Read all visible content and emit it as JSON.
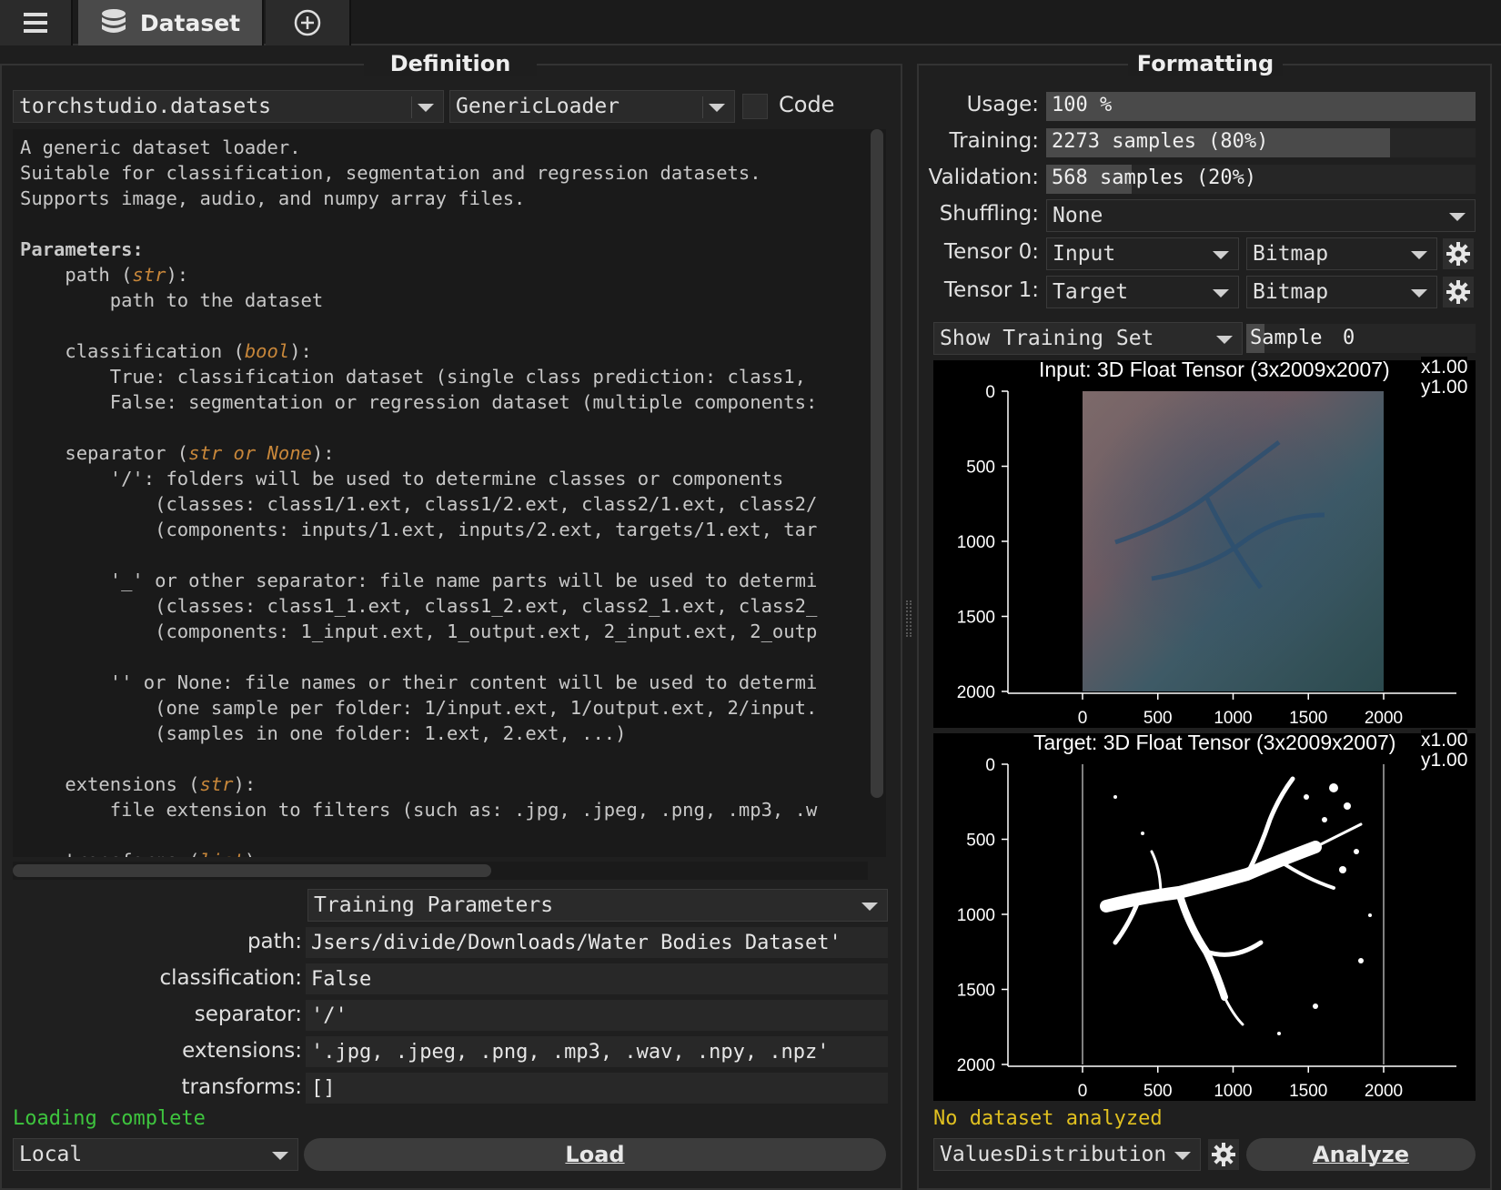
{
  "tabs": {
    "dataset_label": "Dataset"
  },
  "definition": {
    "title": "Definition",
    "module": "torchstudio.datasets",
    "loader": "GenericLoader",
    "code_label": "Code",
    "doc_lines": [
      "A generic dataset loader.",
      "Suitable for classification, segmentation and regression datasets.",
      "Supports image, audio, and numpy array files.",
      "",
      "Parameters:",
      "    path (str):",
      "        path to the dataset",
      "",
      "    classification (bool):",
      "        True: classification dataset (single class prediction: class1, ",
      "        False: segmentation or regression dataset (multiple components: ",
      "",
      "    separator (str or None):",
      "        '/': folders will be used to determine classes or components",
      "            (classes: class1/1.ext, class1/2.ext, class2/1.ext, class2/",
      "            (components: inputs/1.ext, inputs/2.ext, targets/1.ext, tar",
      "",
      "        '_' or other separator: file name parts will be used to determi",
      "            (classes: class1_1.ext, class1_2.ext, class2_1.ext, class2_",
      "            (components: 1_input.ext, 1_output.ext, 2_input.ext, 2_outp",
      "",
      "        '' or None: file names or their content will be used to determi",
      "            (one sample per folder: 1/input.ext, 1/output.ext, 2/input.",
      "            (samples in one folder: 1.ext, 2.ext, ...)",
      "",
      "    extensions (str):",
      "        file extension to filters (such as: .jpg, .jpeg, .png, .mp3, .w",
      "",
      "    transforms (list):"
    ],
    "params_mode": "Training Parameters",
    "params": [
      {
        "label": "path:",
        "value": "Jsers/divide/Downloads/Water Bodies Dataset'"
      },
      {
        "label": "classification:",
        "value": "False"
      },
      {
        "label": "separator:",
        "value": "'/'"
      },
      {
        "label": "extensions:",
        "value": "'.jpg, .jpeg, .png, .mp3, .wav, .npy, .npz'"
      },
      {
        "label": "transforms:",
        "value": "[]"
      }
    ],
    "status": "Loading complete",
    "source": "Local",
    "load_label": "Load"
  },
  "formatting": {
    "title": "Formatting",
    "usage_label": "Usage:",
    "usage_value": "100 %",
    "usage_fraction": 1.0,
    "training_label": "Training:",
    "training_value": "2273 samples (80%)",
    "training_fraction": 0.8,
    "validation_label": "Validation:",
    "validation_value": "568 samples (20%)",
    "validation_fraction": 0.2,
    "shuffling_label": "Shuffling:",
    "shuffling_value": "None",
    "tensor0_label": "Tensor 0:",
    "tensor0_role": "Input",
    "tensor0_format": "Bitmap",
    "tensor1_label": "Tensor 1:",
    "tensor1_role": "Target",
    "tensor1_format": "Bitmap",
    "show_set": "Show Training Set",
    "sample_label": "Sample",
    "sample_value": "0",
    "analysis_status": "No dataset analyzed",
    "analyzer": "ValuesDistribution",
    "analyze_label": "Analyze",
    "status_color": "#e0c020",
    "ok_color": "#3ec43e"
  },
  "chart_data": [
    {
      "type": "image",
      "title": "Input: 3D Float Tensor (3x2009x2007)",
      "zoom_x": "x1.00",
      "zoom_y": "y1.00",
      "xticks": [
        "0",
        "500",
        "1000",
        "1500",
        "2000"
      ],
      "yticks": [
        "0",
        "500",
        "1000",
        "1500",
        "2000"
      ],
      "xlim": [
        0,
        2500
      ],
      "ylim": [
        2000,
        0
      ]
    },
    {
      "type": "image",
      "title": "Target: 3D Float Tensor (3x2009x2007)",
      "zoom_x": "x1.00",
      "zoom_y": "y1.00",
      "xticks": [
        "0",
        "500",
        "1000",
        "1500",
        "2000"
      ],
      "yticks": [
        "0",
        "500",
        "1000",
        "1500",
        "2000"
      ],
      "xlim": [
        0,
        2500
      ],
      "ylim": [
        2000,
        0
      ]
    }
  ]
}
